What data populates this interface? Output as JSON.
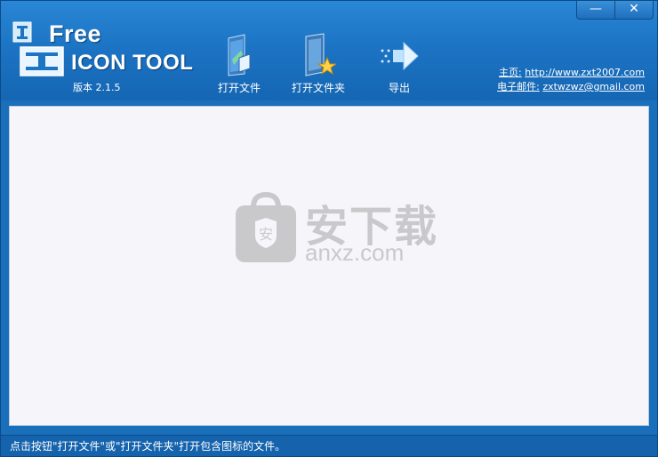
{
  "window": {
    "controls": {
      "minimize": "—",
      "close": "✕"
    }
  },
  "logo": {
    "free_text": "Free",
    "icon_tool_text": "ICON TOOL",
    "version": "版本 2.1.5"
  },
  "toolbar": {
    "open_file": "打开文件",
    "open_folder": "打开文件夹",
    "export": "导出"
  },
  "links": {
    "homepage_label": "主页:",
    "homepage_url": "http://www.zxt2007.com",
    "email_label": "电子邮件:",
    "email": "zxtwzwz@gmail.com"
  },
  "watermark": {
    "main": "安下载",
    "sub": "anxz.com",
    "badge": "安"
  },
  "status": {
    "text": "点击按钮\"打开文件\"或\"打开文件夹\"打开包含图标的文件。"
  },
  "colors": {
    "header": "#1c74c4",
    "status_bar": "#1563ad",
    "content_bg": "#f6f6fa",
    "watermark": "#c9c9cc"
  }
}
